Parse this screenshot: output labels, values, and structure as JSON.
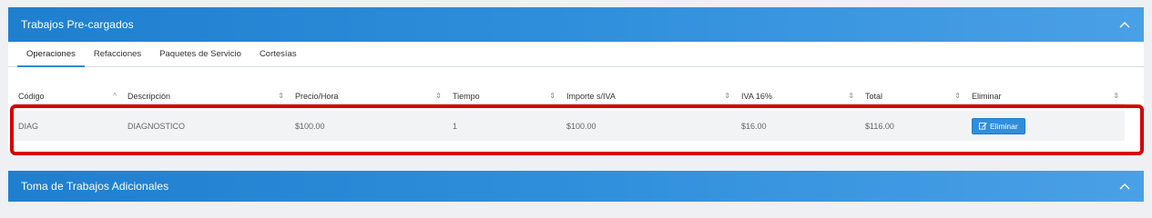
{
  "panel1": {
    "title": "Trabajos Pre-cargados",
    "tabs": [
      {
        "label": "Operaciones",
        "active": true
      },
      {
        "label": "Refacciones",
        "active": false
      },
      {
        "label": "Paquetes de Servicio",
        "active": false
      },
      {
        "label": "Cortesías",
        "active": false
      }
    ],
    "table": {
      "headers": [
        "Código",
        "Descripción",
        "Precio/Hora",
        "Tiempo",
        "Importe s/IVA",
        "IVA 16%",
        "Total",
        "Eliminar"
      ],
      "rows": [
        {
          "codigo": "DIAG",
          "descripcion": "DIAGNOSTICO",
          "precio_hora": "$100.00",
          "tiempo": "1",
          "importe": "$100.00",
          "iva": "$16.00",
          "total": "$116.00",
          "eliminar_label": "Eliminar"
        }
      ]
    }
  },
  "panel2": {
    "title": "Toma de Trabajos Adicionales"
  },
  "colors": {
    "header_blue": "#2f8fdc",
    "highlight_red": "#d40000",
    "button_blue": "#2f8fdc"
  },
  "icons": {
    "collapse": "chevron-up-icon",
    "sort": "sort-icon",
    "edit": "edit-icon"
  }
}
